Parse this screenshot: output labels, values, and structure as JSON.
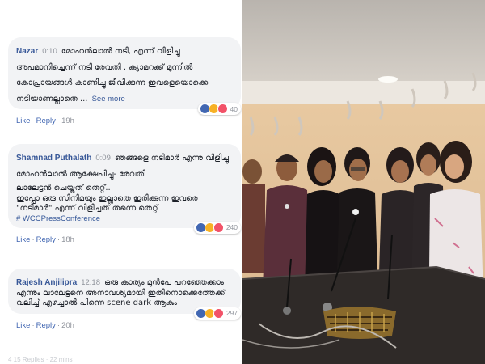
{
  "comments": [
    {
      "author": "Nazar",
      "time": "0:10",
      "text": "മോഹൻലാൽ നടി, എന്ന് വിളിച്ചു അപമാനിച്ചെന്ന് നടി രേവതി . ക്യാമറക്ക് മുന്നിൽ കോപ്രായങ്ങൾ കാണിച്ചു ജീവിക്കുന്ന ഇവളെയൊക്കെ നടിയാണല്ലാതെ ...",
      "see_more": "See more",
      "reactions": "40",
      "like": "Like",
      "reply": "Reply",
      "age": "19h"
    },
    {
      "author": "Shamnad Puthalath",
      "time": "0:09",
      "text": "ഞങ്ങളെ നടിമാർ എന്നു വിളിച്ചു മോഹൻലാൽ ആക്ഷേപിച്ചു- രേവതി",
      "text2": "ലാലേട്ടൻ ചെയ്തത് തെറ്റ്..\nഇപ്പോ ഒരു സിനിമയും ഇല്ലാതെ ഇരിക്കുന്ന ഇവരെ \"നടിമാർ\" എന്ന് വിളിച്ചത് തന്നെ തെറ്റ്",
      "tag": "# WCCPressConference",
      "reactions": "240",
      "like": "Like",
      "reply": "Reply",
      "age": "18h"
    },
    {
      "author": "Rajesh Anjilipra",
      "time": "12:18",
      "text": "ഒരു കാര്യം മുൻപേ പറഞ്ഞേക്കാം",
      "text2": "എന്നും ലാലേട്ടനെ അനാവശ്യമായി ഇതിനൊക്കെത്തേക്ക് വലിച്ച് എഴച്ചാൽ പിന്നെ scene dark ആകും",
      "reactions": "297",
      "like": "Like",
      "reply": "Reply",
      "age": "20h"
    }
  ],
  "more_replies": "4 15 Replies · 22 mins",
  "colors": {
    "link": "#385898",
    "bubble": "#f2f3f5",
    "meta": "#90949c"
  },
  "icons": [
    "like-icon",
    "haha-icon",
    "love-icon"
  ]
}
